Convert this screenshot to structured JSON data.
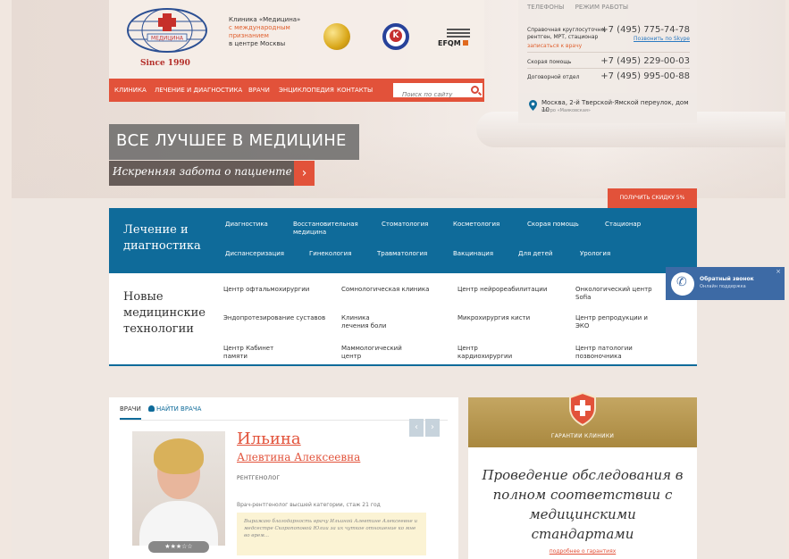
{
  "header": {
    "since": "Since 1990",
    "clinic_line1": "Клиника «Медицина»",
    "clinic_line2": "с международным",
    "clinic_line3": "признанием",
    "clinic_line4": "в центре Москвы",
    "efqm": "EFQM",
    "badge_q": "K"
  },
  "topnav": {
    "items": [
      "КЛИНИКА",
      "ЛЕЧЕНИЕ И ДИАГНОСТИКА",
      "ВРАЧИ",
      "ЭНЦИКЛОПЕДИЯ",
      "КОНТАКТЫ"
    ],
    "search_placeholder": "Поиск по сайту"
  },
  "contacts": {
    "tab1": "ТЕЛЕФОНЫ",
    "tab2": "РЕЖИМ РАБОТЫ",
    "row1_label": "Справочная круглосуточно,",
    "row1_label2": "рентген, МРТ, стационар",
    "row1_phone": "+7 (495) 775-74-78",
    "skype": "Позвонить по Skype",
    "signup": "записаться к врачу",
    "row2_label": "Скорая помощь",
    "row2_phone": "+7 (495) 229-00-03",
    "row3_label": "Договорной отдел",
    "row3_phone": "+7 (495) 995-00-88",
    "address": "Москва, 2-й Тверской-Ямской переулок, дом 10",
    "metro": "метро «Маяковская»"
  },
  "hero": {
    "slogan": "ВСЕ ЛУЧШЕЕ В МЕДИЦИНЕ",
    "subslogan": "Искренняя забота о пациенте",
    "arrow": "›",
    "discount": "ПОЛУЧИТЬ СКИДКУ 5%"
  },
  "treatment": {
    "title": "Лечение и диагностика",
    "row1": [
      "Диагностика",
      "Восстановительная медицина",
      "Стоматология",
      "Косметология",
      "Скорая помощь",
      "Стационар"
    ],
    "row2": [
      "Диспансеризация",
      "Гинекология",
      "Травматология",
      "Вакцинация",
      "Для детей",
      "Урология"
    ]
  },
  "technologies": {
    "title": "Новые медицинские технологии",
    "items": [
      "Центр офтальмохирургии",
      "Сомнологическая клиника",
      "Центр нейрореабилитации",
      "Онкологический центр Sofia",
      "Эндопротезирование суставов",
      "Клиника лечения боли",
      "Микрохирургия кисти",
      "Центр репродукции и ЭКО",
      "Центр Кабинет памяти",
      "Маммологический центр",
      "Центр кардиохирургии",
      "Центр патологии позвоночника"
    ]
  },
  "doctors": {
    "tab_active": "ВРАЧИ",
    "tab_find": "НАЙТИ ВРАЧА",
    "prev": "‹",
    "next": "›",
    "surname": "Ильина",
    "name": "Алевтина Алексеевна",
    "specialty": "РЕНТГЕНОЛОГ",
    "description": "Врач-рентгенолог высшей категории, стаж 21 год",
    "review": "Выражаю благодарность врачу Ильиной Алевтине Алексеевне и медсестре Скоропоповой Юлии за их чуткое отношение ко мне во врем...",
    "stars": "★★★☆☆",
    "rating": 3
  },
  "guarantees": {
    "label": "ГАРАНТИИ КЛИНИКИ",
    "text": "Проведение обследования в полном соответствии с медицинскими стандартами",
    "link": "подробнее о гарантиях"
  },
  "callback": {
    "title": "Обратный звонок",
    "subtitle": "Онлайн поддержка",
    "close": "×"
  },
  "colors": {
    "accent": "#e2523a",
    "blue": "#0f6b9a",
    "gold": "#b4944c"
  }
}
